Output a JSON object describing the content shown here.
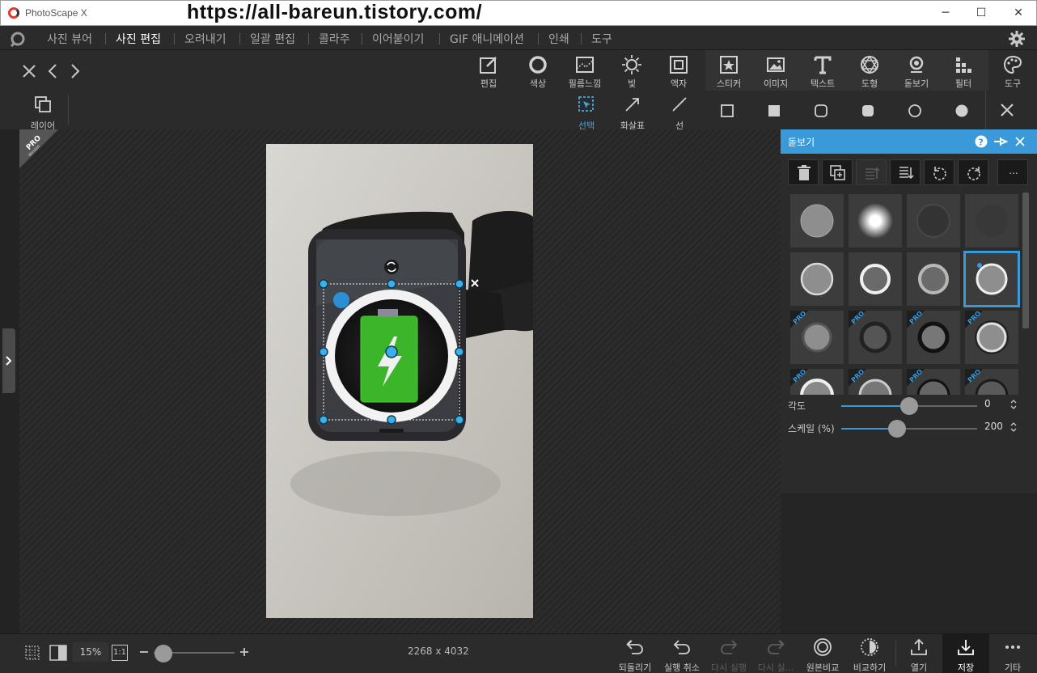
{
  "title_bar": {
    "app_title": "PhotoScape X",
    "watermark": "https://all-bareun.tistory.com/",
    "minimize_icon": "─",
    "maximize_icon": "☐",
    "close_icon": "✕"
  },
  "menu": {
    "items": [
      {
        "label": "사진 뷰어",
        "active": false
      },
      {
        "label": "사진 편집",
        "active": true
      },
      {
        "label": "오려내기",
        "active": false
      },
      {
        "label": "일괄 편집",
        "active": false
      },
      {
        "label": "콜라주",
        "active": false
      },
      {
        "label": "이어붙이기",
        "active": false
      },
      {
        "label": "GIF 애니메이션",
        "active": false
      },
      {
        "label": "인쇄",
        "active": false
      },
      {
        "label": "도구",
        "active": false
      }
    ]
  },
  "toolbar": {
    "tools": [
      {
        "label": "편집",
        "icon": "edit-icon"
      },
      {
        "label": "색상",
        "icon": "color-icon"
      },
      {
        "label": "필름느낌",
        "icon": "film-icon"
      },
      {
        "label": "빛",
        "icon": "light-icon"
      },
      {
        "label": "액자",
        "icon": "frame-icon"
      },
      {
        "label": "스티커",
        "icon": "sticker-icon"
      },
      {
        "label": "이미지",
        "icon": "image-icon"
      },
      {
        "label": "텍스트",
        "icon": "text-icon"
      },
      {
        "label": "도형",
        "icon": "shape-icon"
      },
      {
        "label": "돋보기",
        "icon": "magnifier-icon"
      },
      {
        "label": "필터",
        "icon": "filter-icon"
      },
      {
        "label": "도구",
        "icon": "palette-icon"
      }
    ]
  },
  "subtoolbar": {
    "layer_label": "레이어",
    "select_label": "선택",
    "arrow_label": "화살표",
    "line_label": "선"
  },
  "canvas": {
    "pro_badge": "PRO",
    "pro_sub": "Version"
  },
  "panel": {
    "title": "돋보기",
    "more_label": "...",
    "angle_label": "각도",
    "angle_value": "0",
    "scale_label": "스케일 (%)",
    "scale_value": "200",
    "angle_fraction": 0.5,
    "scale_fraction": 0.41,
    "pro_tag": "PRO",
    "selected_tile": 7
  },
  "bottom": {
    "zoom": "15%",
    "one_to_one": "1:1",
    "image_size": "2268 x 4032",
    "zoom_fraction": 0.12,
    "actions": [
      {
        "label": "되돌리기",
        "disabled": false
      },
      {
        "label": "실행 취소",
        "disabled": false
      },
      {
        "label": "다시 실행",
        "disabled": true
      },
      {
        "label": "다시 실...",
        "disabled": true
      },
      {
        "label": "원본비교",
        "disabled": false
      },
      {
        "label": "비교하기",
        "disabled": false
      },
      {
        "label": "열기",
        "disabled": false
      },
      {
        "label": "저장",
        "disabled": false
      },
      {
        "label": "기타",
        "disabled": false
      }
    ]
  },
  "colors": {
    "accent": "#3a9ad9",
    "background": "#232323",
    "toolbar": "#2b2b2b"
  }
}
